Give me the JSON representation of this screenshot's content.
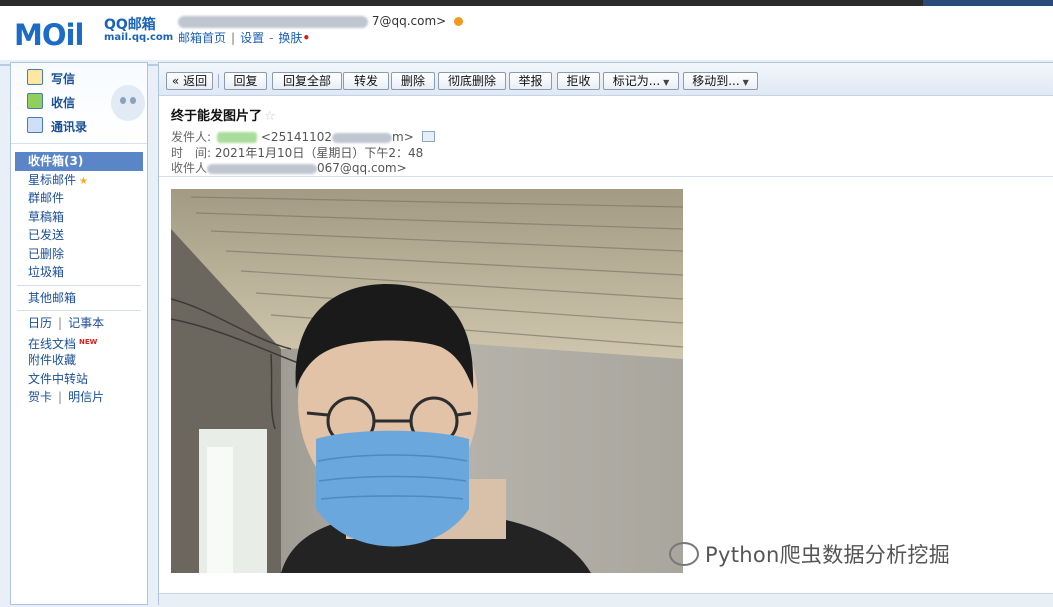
{
  "header": {
    "logo_text": "MOil",
    "brand_name": "QQ邮箱",
    "brand_domain": "mail.qq.com",
    "user_suffix": "7@qq.com>",
    "links": [
      "邮箱首页",
      "设置",
      "换肤"
    ]
  },
  "sidebar": {
    "quick": [
      {
        "label": "写信",
        "icon": "pencil-icon"
      },
      {
        "label": "收信",
        "icon": "inbox-download-icon"
      },
      {
        "label": "通讯录",
        "icon": "contacts-icon"
      }
    ],
    "inbox": "收件箱(3)",
    "folders": [
      "星标邮件",
      "群邮件",
      "草稿箱",
      "已发送",
      "已删除",
      "垃圾箱"
    ],
    "other": "其他邮箱",
    "tools": {
      "calendar": "日历",
      "notes": "记事本",
      "docs": "在线文档",
      "docs_badge": "NEW",
      "attachments": "附件收藏",
      "transfer": "文件中转站",
      "cards": "贺卡",
      "postcards": "明信片"
    }
  },
  "toolbar": {
    "back": "« 返回",
    "reply": "回复",
    "reply_all": "回复全部",
    "forward": "转发",
    "delete": "删除",
    "delete_perm": "彻底删除",
    "report": "举报",
    "reject": "拒收",
    "mark_as": "标记为...",
    "move_to": "移动到..."
  },
  "email": {
    "subject": "终于能发图片了",
    "from_label": "发件人:",
    "from_value": "<25141102",
    "from_suffix": "m>",
    "time_label": "时　间:",
    "time_value": "2021年1月10日（星期日）下午2：48",
    "to_label": "收件人",
    "to_value": "067@qq.com>"
  },
  "watermark": "Python爬虫数据分析挖掘",
  "colors": {
    "accent": "#5a86c8",
    "link": "#1b4f96",
    "mask_blue": "#6aa7dc"
  }
}
